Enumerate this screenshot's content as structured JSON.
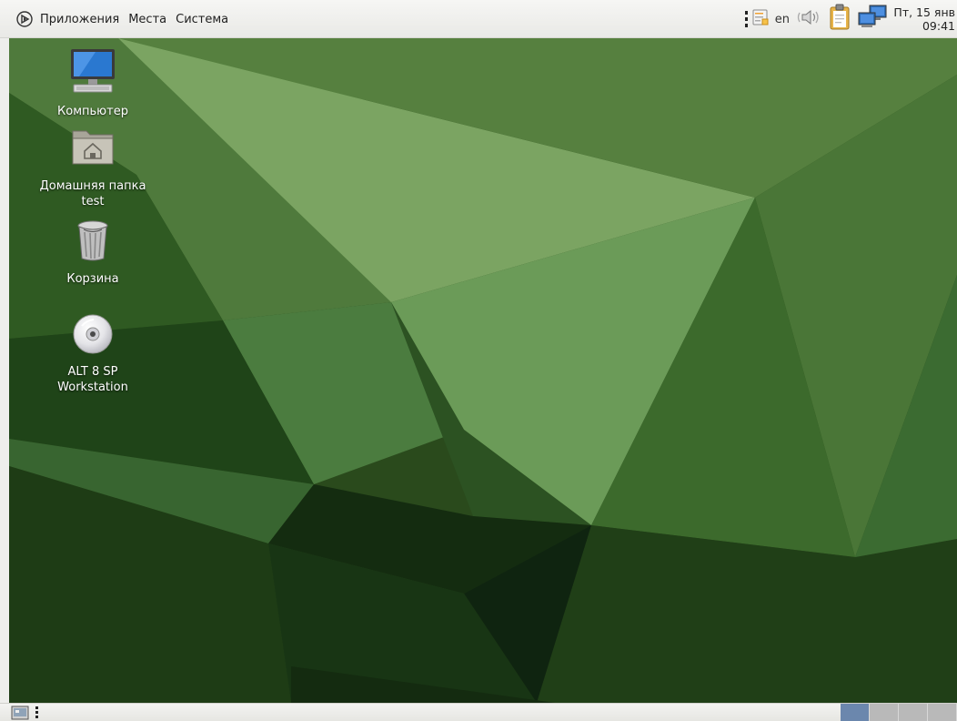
{
  "top_panel": {
    "menu": {
      "applications": "Приложения",
      "places": "Места",
      "system": "Система"
    },
    "tray": {
      "keyboard_layout": "en",
      "clock_date": "Пт, 15 янв",
      "clock_time": "09:41",
      "icons": [
        "notes-applet-icon",
        "volume-icon",
        "clipboard-icon",
        "network-icon"
      ]
    }
  },
  "desktop": {
    "icons": [
      {
        "name": "computer-icon",
        "label": "Компьютер"
      },
      {
        "name": "home-folder-icon",
        "label": "Домашняя папка test"
      },
      {
        "name": "trash-icon",
        "label": "Корзина"
      },
      {
        "name": "cdrom-icon",
        "label": "ALT 8 SP Workstation"
      }
    ]
  },
  "bottom_panel": {
    "workspaces": {
      "count": 4,
      "active_index": 0
    }
  },
  "colors": {
    "panel_bg": "#eeeeec",
    "workspace_active": "#6b87ad",
    "workspace_inactive": "#b9b9b9",
    "wallpaper_dark": "#1f3c14",
    "wallpaper_light": "#8ab07a"
  }
}
